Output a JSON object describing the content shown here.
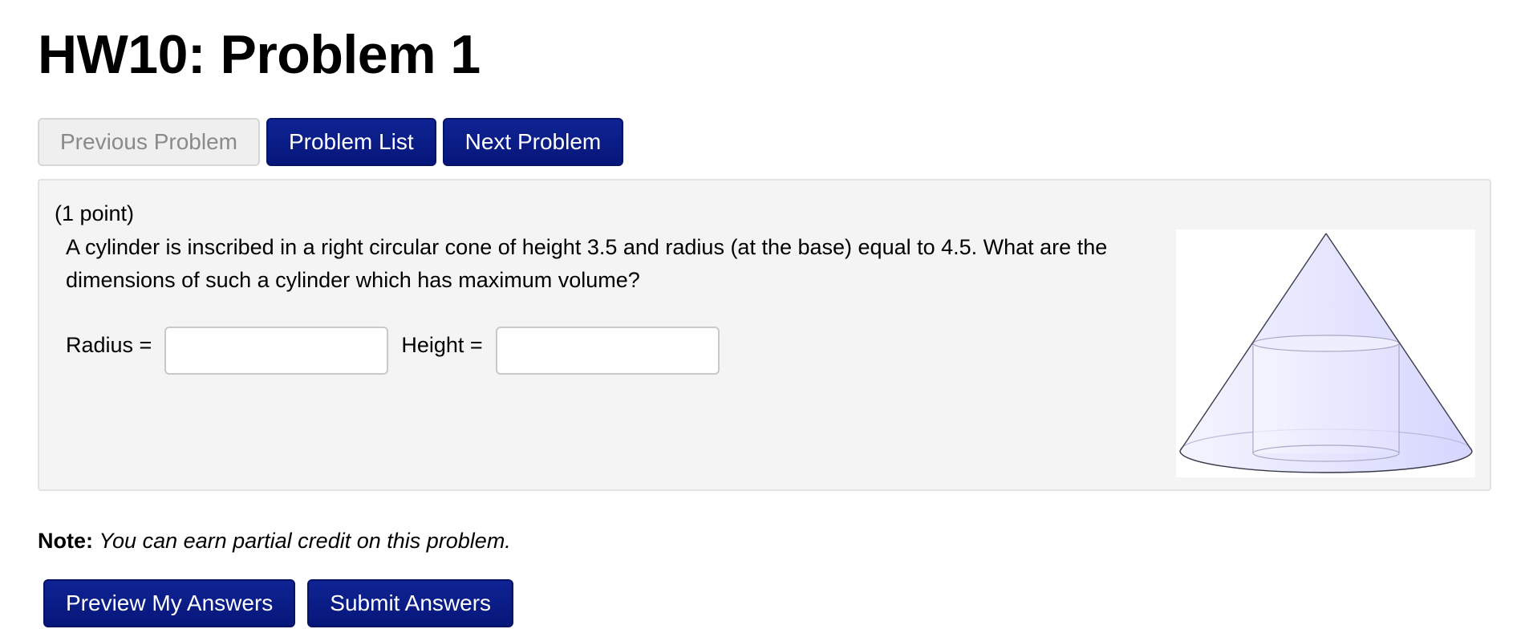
{
  "page": {
    "title": "HW10: Problem 1"
  },
  "nav": {
    "previous_label": "Previous Problem",
    "list_label": "Problem List",
    "next_label": "Next Problem"
  },
  "problem": {
    "points": "(1 point)",
    "question": "A cylinder is inscribed in a right circular cone of height 3.5 and radius (at the base) equal to 4.5. What are the dimensions of such a cylinder which has maximum volume?",
    "radius_label": "Radius =",
    "radius_value": "",
    "height_label": "Height =",
    "height_value": ""
  },
  "figure": {
    "icon": "cone-with-inscribed-cylinder-icon",
    "fill_color": "#e8e8ff"
  },
  "note": {
    "label": "Note:",
    "text": "You can earn partial credit on this problem."
  },
  "actions": {
    "preview_label": "Preview My Answers",
    "submit_label": "Submit Answers"
  },
  "colors": {
    "primary_button": "#0a1c86",
    "disabled_button": "#efefef",
    "panel_background": "#f4f4f4"
  }
}
